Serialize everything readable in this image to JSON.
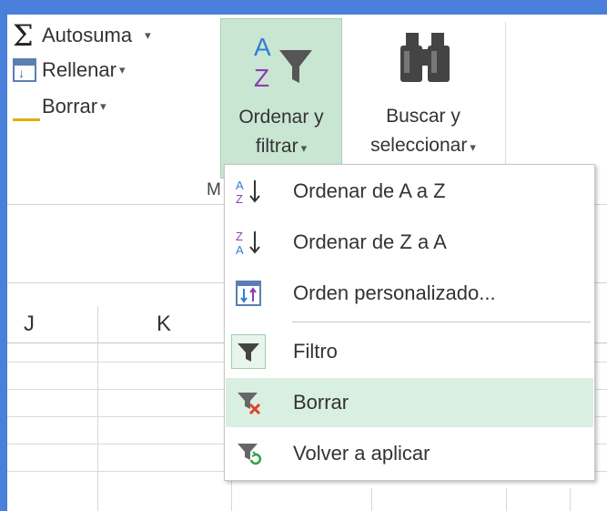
{
  "ribbon": {
    "autosum_label": "Autosuma",
    "fill_label": "Rellenar",
    "clear_label": "Borrar",
    "sort_filter_line1": "Ordenar y",
    "sort_filter_line2": "filtrar",
    "find_select_line1": "Buscar y",
    "find_select_line2": "seleccionar",
    "group_label_fragment": "M",
    "caret": "▾"
  },
  "sheet": {
    "columns": [
      "J",
      "K"
    ]
  },
  "menu": {
    "items": [
      {
        "label": "Ordenar de A a Z",
        "icon": "sort-a-to-z-icon"
      },
      {
        "label": "Ordenar de Z a A",
        "icon": "sort-z-to-a-icon"
      },
      {
        "label": "Orden personalizado...",
        "icon": "custom-sort-icon"
      },
      {
        "label": "Filtro",
        "icon": "filter-icon"
      },
      {
        "label": "Borrar",
        "icon": "clear-filter-icon"
      },
      {
        "label": "Volver a aplicar",
        "icon": "reapply-icon"
      }
    ]
  },
  "colors": {
    "window_border": "#4a7fdb",
    "selected_button": "#c9e6d2",
    "menu_hover": "#d9efe1"
  }
}
